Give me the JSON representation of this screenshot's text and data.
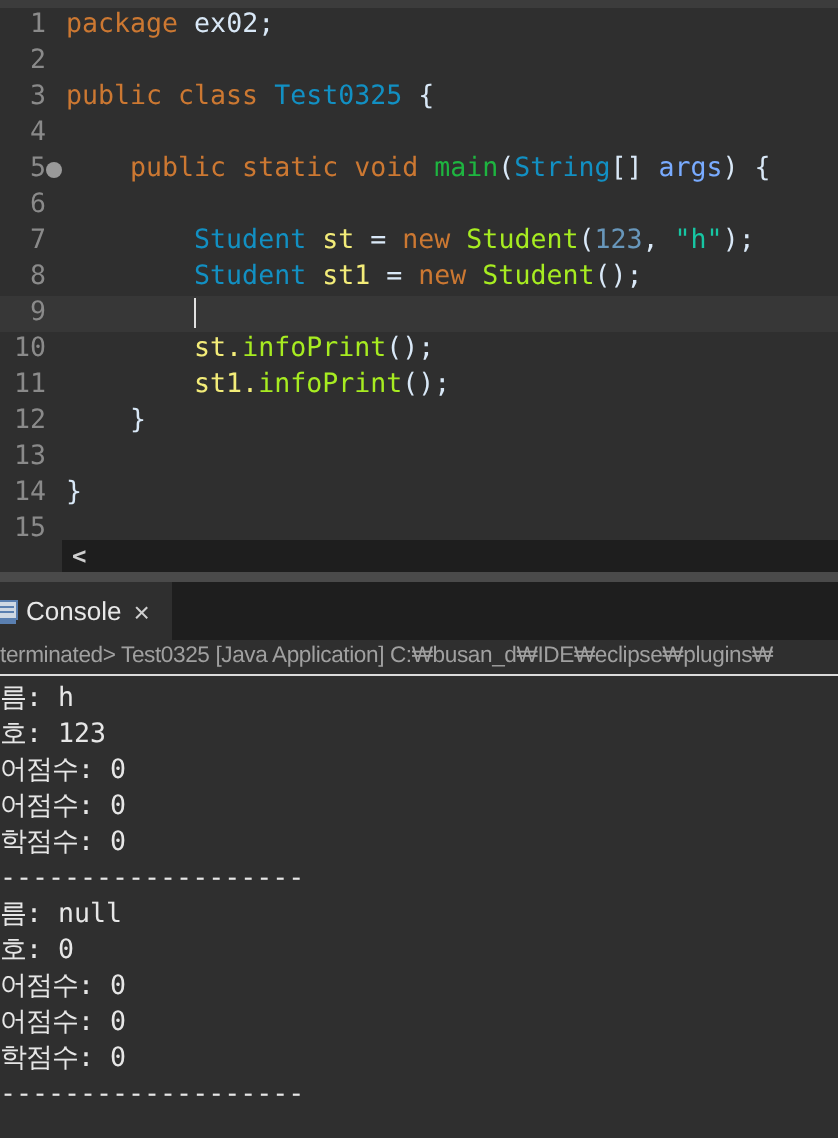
{
  "editor": {
    "lines": [
      {
        "number": "1",
        "fold": false,
        "current": false,
        "tokens": [
          {
            "kind": "keyword",
            "text": "package"
          },
          {
            "kind": "plain",
            "text": " ex02;"
          }
        ]
      },
      {
        "number": "2",
        "fold": false,
        "current": false
      },
      {
        "number": "3",
        "fold": false,
        "current": false,
        "tokens": [
          {
            "kind": "keyword",
            "text": "public class"
          },
          {
            "kind": "type",
            "text": " Test0325"
          },
          {
            "kind": "plain",
            "text": " {"
          }
        ]
      },
      {
        "number": "4",
        "fold": false,
        "current": false
      },
      {
        "number": "5",
        "fold": true,
        "current": false,
        "tokens": [
          {
            "kind": "keyword",
            "text": "    public static void"
          },
          {
            "kind": "method",
            "text": " main"
          },
          {
            "kind": "plain",
            "text": "("
          },
          {
            "kind": "type",
            "text": "String"
          },
          {
            "kind": "plain",
            "text": "[]"
          },
          {
            "kind": "param",
            "text": " args"
          },
          {
            "kind": "plain",
            "text": ") {"
          }
        ]
      },
      {
        "number": "6",
        "fold": false,
        "current": false
      },
      {
        "number": "7",
        "fold": false,
        "current": false,
        "tokens": [
          {
            "kind": "type",
            "text": "        Student"
          },
          {
            "kind": "var",
            "text": " st"
          },
          {
            "kind": "plain",
            "text": " ="
          },
          {
            "kind": "keyword",
            "text": " new"
          },
          {
            "kind": "call",
            "text": " Student"
          },
          {
            "kind": "plain",
            "text": "("
          },
          {
            "kind": "number",
            "text": "123"
          },
          {
            "kind": "plain",
            "text": ","
          },
          {
            "kind": "string",
            "text": " \"h\""
          },
          {
            "kind": "plain",
            "text": ");"
          }
        ]
      },
      {
        "number": "8",
        "fold": false,
        "current": false,
        "tokens": [
          {
            "kind": "type",
            "text": "        Student"
          },
          {
            "kind": "var",
            "text": " st1"
          },
          {
            "kind": "plain",
            "text": " ="
          },
          {
            "kind": "keyword",
            "text": " new"
          },
          {
            "kind": "call",
            "text": " Student"
          },
          {
            "kind": "plain",
            "text": "();"
          }
        ]
      },
      {
        "number": "9",
        "fold": false,
        "current": true
      },
      {
        "number": "10",
        "fold": false,
        "current": false,
        "tokens": [
          {
            "kind": "var",
            "text": "        st."
          },
          {
            "kind": "call",
            "text": "infoPrint"
          },
          {
            "kind": "plain",
            "text": "();"
          }
        ]
      },
      {
        "number": "11",
        "fold": false,
        "current": false,
        "tokens": [
          {
            "kind": "var",
            "text": "        st1."
          },
          {
            "kind": "call",
            "text": "infoPrint"
          },
          {
            "kind": "plain",
            "text": "();"
          }
        ]
      },
      {
        "number": "12",
        "fold": false,
        "current": false,
        "tokens": [
          {
            "kind": "plain",
            "text": "    }"
          }
        ]
      },
      {
        "number": "13",
        "fold": false,
        "current": false
      },
      {
        "number": "14",
        "fold": false,
        "current": false,
        "tokens": [
          {
            "kind": "plain",
            "text": "}"
          }
        ]
      },
      {
        "number": "15",
        "fold": false,
        "current": false
      }
    ],
    "scroll_left": "<"
  },
  "console": {
    "tab": {
      "label": "Console",
      "close": "×"
    },
    "header": "terminated> Test0325 [Java Application] C:₩busan_d₩IDE₩eclipse₩plugins₩",
    "lines": [
      "름: h",
      "호: 123",
      "어점수: 0",
      "어점수: 0",
      "학점수: 0",
      "-------------------",
      "름: null",
      "호: 0",
      "어점수: 0",
      "어점수: 0",
      "학점수: 0",
      "-------------------"
    ]
  }
}
